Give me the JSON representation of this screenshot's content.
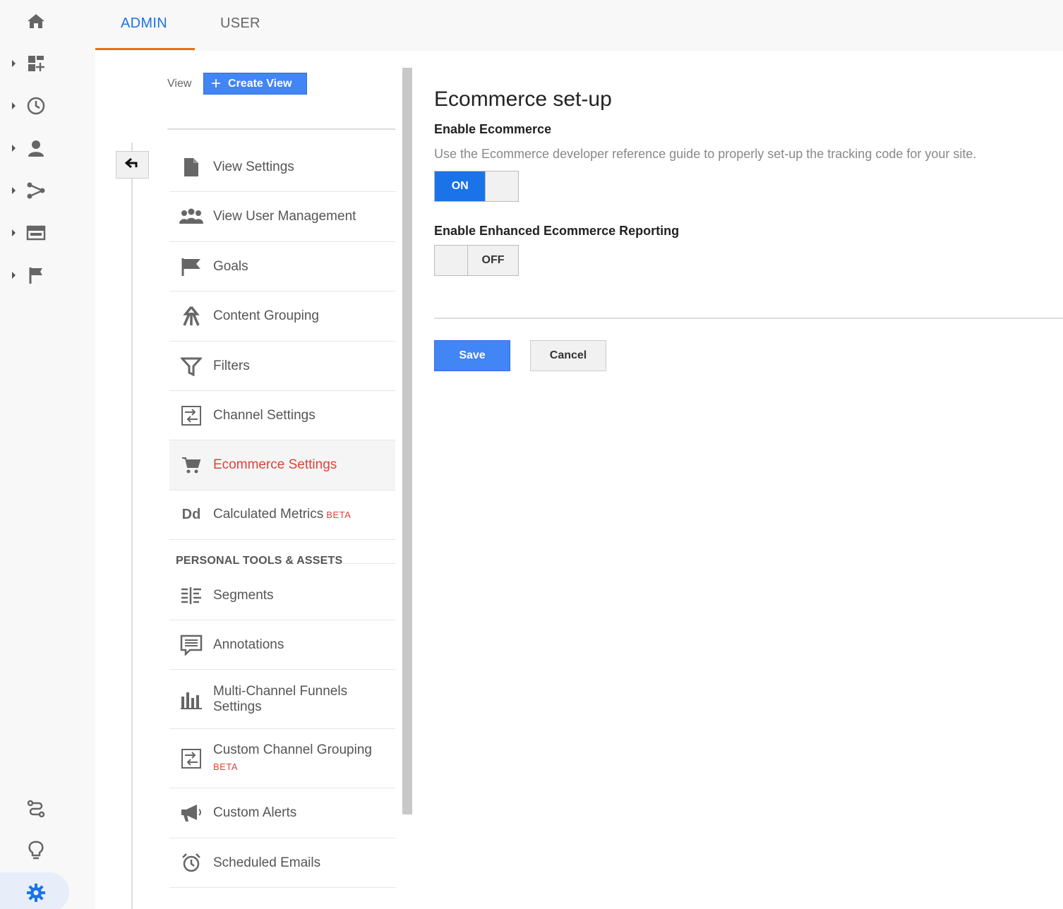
{
  "tabs": {
    "admin": "ADMIN",
    "user": "USER"
  },
  "view_column": {
    "view_label": "View",
    "create_view_plus": "+",
    "create_view_label": "Create View"
  },
  "nav": {
    "items": [
      {
        "label": "View Settings",
        "icon": "document-icon"
      },
      {
        "label": "View User Management",
        "icon": "people-icon"
      },
      {
        "label": "Goals",
        "icon": "flag-icon"
      },
      {
        "label": "Content Grouping",
        "icon": "content-grouping-icon"
      },
      {
        "label": "Filters",
        "icon": "filter-icon"
      },
      {
        "label": "Channel Settings",
        "icon": "channel-settings-icon"
      },
      {
        "label": "Ecommerce Settings",
        "icon": "cart-icon",
        "active": true
      },
      {
        "label": "Calculated Metrics",
        "badge": "BETA",
        "icon": "Dd"
      }
    ],
    "section_title": "PERSONAL TOOLS & ASSETS",
    "personal_items": [
      {
        "label": "Segments",
        "icon": "segments-icon"
      },
      {
        "label": "Annotations",
        "icon": "annotations-icon"
      },
      {
        "label": "Multi-Channel Funnels Settings",
        "icon": "bar-chart-icon"
      },
      {
        "label": "Custom Channel Grouping",
        "badge": "BETA",
        "icon": "custom-channel-icon"
      },
      {
        "label": "Custom Alerts",
        "icon": "megaphone-icon"
      },
      {
        "label": "Scheduled Emails",
        "icon": "alarm-clock-icon"
      }
    ]
  },
  "main": {
    "title": "Ecommerce set-up",
    "enable_ecommerce": {
      "label": "Enable Ecommerce",
      "help": "Use the Ecommerce developer reference guide to properly set-up the tracking code for your site.",
      "state": "ON"
    },
    "enhanced": {
      "label": "Enable Enhanced Ecommerce Reporting",
      "state": "OFF"
    },
    "save_label": "Save",
    "cancel_label": "Cancel"
  },
  "colors": {
    "accent_blue": "#1a73e8",
    "button_blue": "#4285f4",
    "active_red": "#db4437",
    "tab_underline": "#e8710a"
  }
}
